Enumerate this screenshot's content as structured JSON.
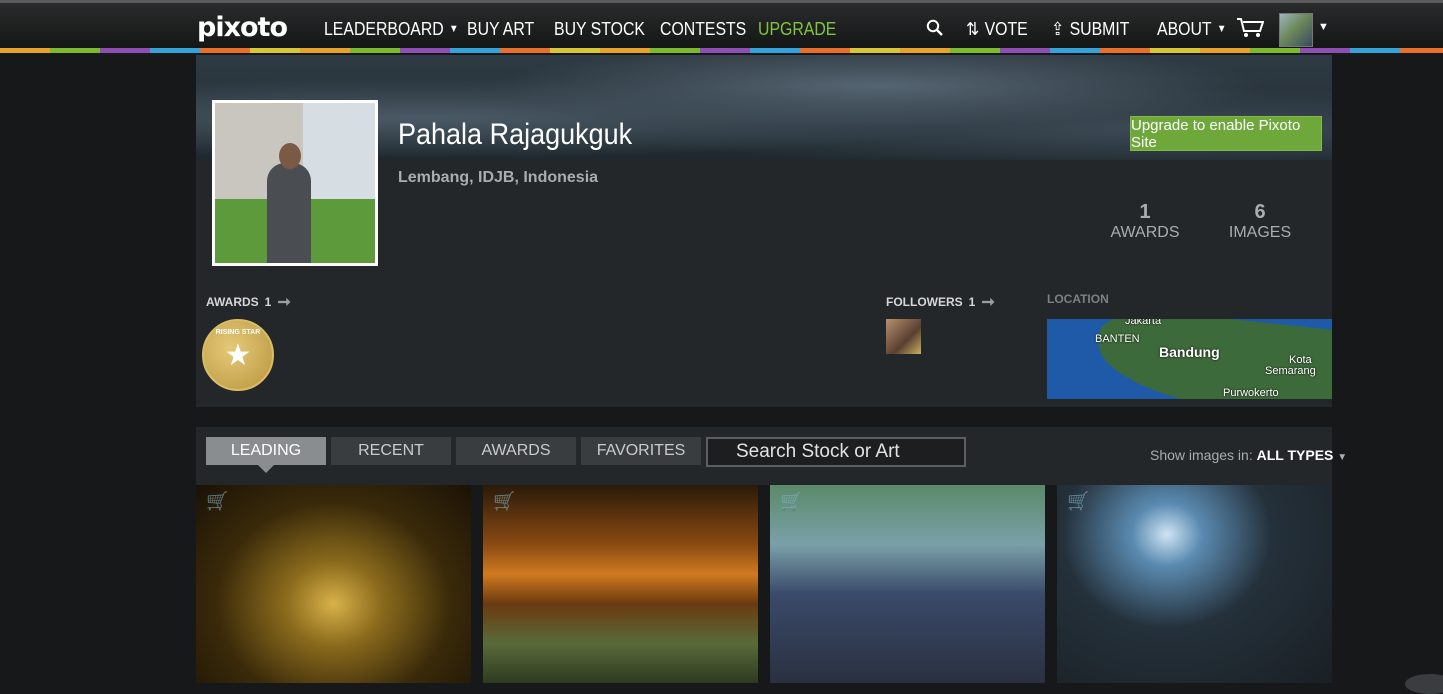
{
  "nav": {
    "logo": "pixoto",
    "items": [
      {
        "label": "LEADERBOARD",
        "caret": true
      },
      {
        "label": "BUY ART"
      },
      {
        "label": "BUY STOCK"
      },
      {
        "label": "CONTESTS"
      },
      {
        "label": "UPGRADE",
        "accent": "#82c341"
      }
    ],
    "right": {
      "vote": "VOTE",
      "submit": "SUBMIT",
      "about": "ABOUT"
    }
  },
  "profile": {
    "name": "Pahala Rajagukguk",
    "location": "Lembang, IDJB, Indonesia",
    "upgrade_button": "Upgrade to enable Pixoto Site",
    "stats": {
      "awards_num": "1",
      "awards_label": "AWARDS",
      "images_num": "6",
      "images_label": "IMAGES"
    },
    "sections": {
      "awards_label": "AWARDS",
      "awards_count": "1",
      "followers_label": "FOLLOWERS",
      "followers_count": "1",
      "location_label": "LOCATION"
    },
    "badge_text": "RISING STAR",
    "map_labels": {
      "jakarta": "Jakarta",
      "banten": "BANTEN",
      "bandung": "Bandung",
      "kota": "Kota",
      "semarang": "Semarang",
      "purwokerto": "Purwokerto"
    }
  },
  "gallery": {
    "tabs": [
      "LEADING",
      "RECENT",
      "AWARDS",
      "FAVORITES"
    ],
    "active_tab": "LEADING",
    "search_placeholder": "Search Stock or Art",
    "show_label": "Show images in:",
    "show_value": "ALL TYPES"
  },
  "colors": {
    "accent_green": "#82c341",
    "upgrade_button": "#6ea83a",
    "panel": "#23272a"
  }
}
